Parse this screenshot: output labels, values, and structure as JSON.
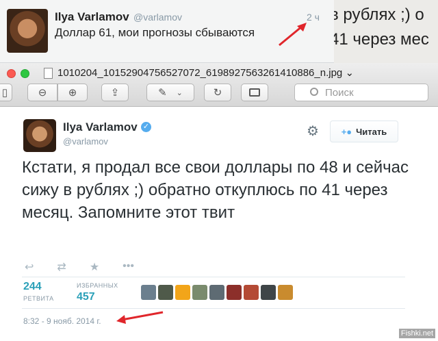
{
  "top_tweet": {
    "name": "Ilya Varlamov",
    "handle": "@varlamov",
    "time": "2 ч",
    "text": "Доллар 61, мои прогнозы сбываются"
  },
  "background_page": {
    "lines": [
      "в рублях ;) о",
      "41 через мес"
    ]
  },
  "window": {
    "file_name": "1010204_10152904756527072_6198927563261410886_n.jpg ⌄",
    "search_placeholder": "Поиск"
  },
  "tweet": {
    "name": "Ilya Varlamov",
    "handle": "@varlamov",
    "follow_label": "Читать",
    "text": "Кстати, я продал все свои доллары по 48 и сейчас сижу в рублях ;) обратно откуплюсь по 41 через месяц. Запомните этот твит",
    "retweets_count": "244",
    "retweets_label": "РЕТВИТА",
    "favorites_label": "ИЗБРАННЫХ",
    "favorites_count": "457",
    "date": "8:32 - 9 нояб. 2014 г."
  },
  "icons": {
    "reply": "↩",
    "retweet": "⇄",
    "favorite": "★",
    "more": "•••",
    "gear": "⚙",
    "verified": "✓",
    "add_user": "+👤",
    "zoom_out": "⊖",
    "zoom_in": "⊕",
    "share": "⇪",
    "pen": "✎",
    "rotate": "↻",
    "toolbox": "🧰"
  },
  "watermark": "Fishki.net",
  "colors": {
    "link": "#2aa0b8",
    "verified": "#55acee",
    "arrow": "#e0262b"
  }
}
